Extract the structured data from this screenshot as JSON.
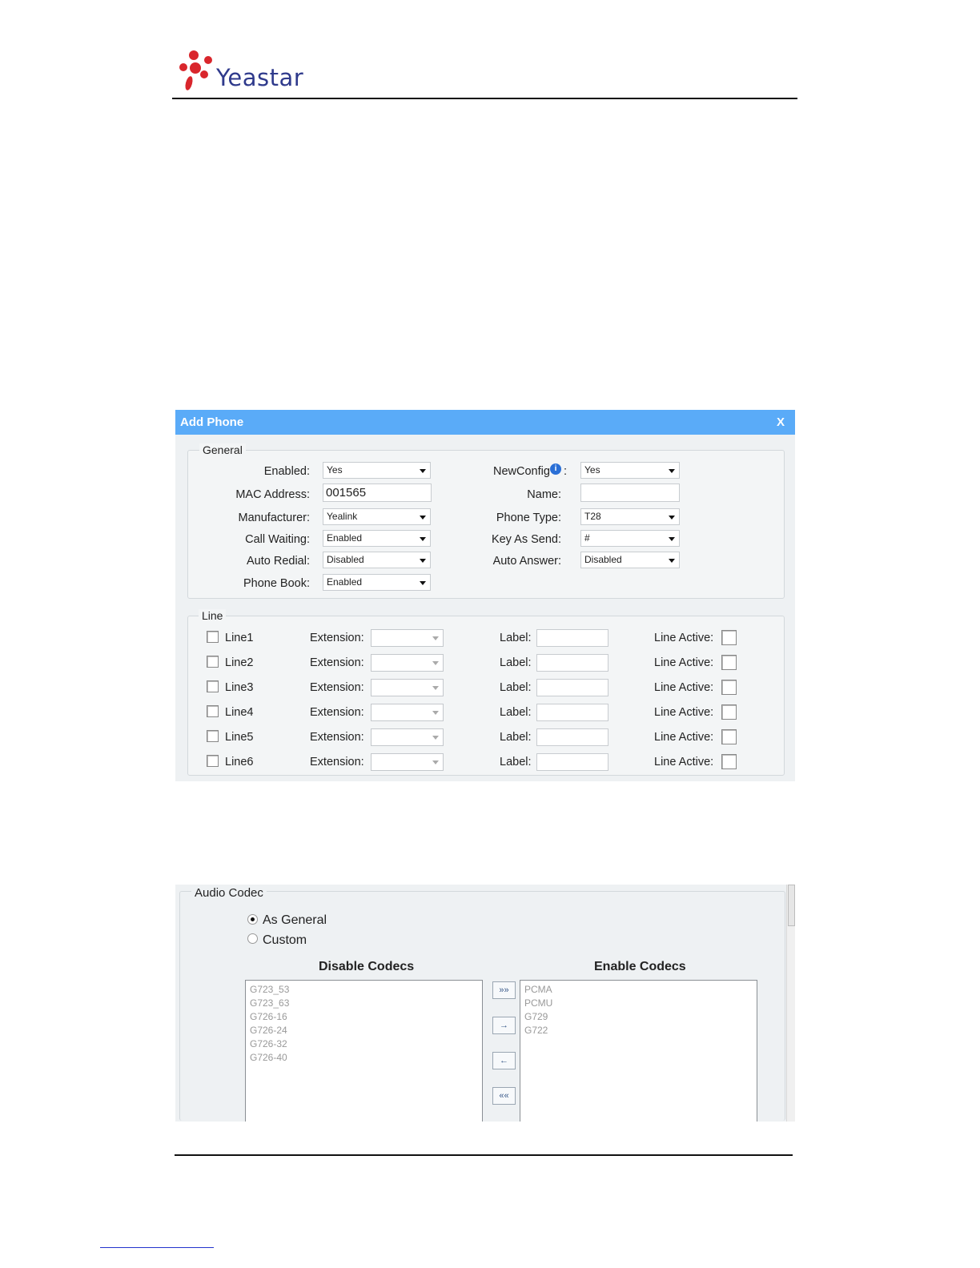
{
  "header": {
    "logo_text": "Yeastar"
  },
  "add_phone": {
    "title": "Add Phone",
    "close_label": "X",
    "general": {
      "legend": "General",
      "left": [
        {
          "label": "Enabled:",
          "value": "Yes",
          "kind": "select"
        },
        {
          "label": "MAC Address:",
          "value": "001565",
          "kind": "input"
        },
        {
          "label": "Manufacturer:",
          "value": "Yealink",
          "kind": "select"
        },
        {
          "label": "Call Waiting:",
          "value": "Enabled",
          "kind": "select"
        },
        {
          "label": "Auto Redial:",
          "value": "Disabled",
          "kind": "select"
        },
        {
          "label": "Phone Book:",
          "value": "Enabled",
          "kind": "select"
        }
      ],
      "right": [
        {
          "label": "NewConfig",
          "value": "Yes",
          "kind": "select",
          "info": true
        },
        {
          "label": "Name:",
          "value": "",
          "kind": "input"
        },
        {
          "label": "Phone Type:",
          "value": "T28",
          "kind": "select"
        },
        {
          "label": "Key As Send:",
          "value": "#",
          "kind": "select"
        },
        {
          "label": "Auto Answer:",
          "value": "Disabled",
          "kind": "select"
        }
      ],
      "newconfig_suffix": ":"
    },
    "line": {
      "legend": "Line",
      "extension_label": "Extension:",
      "label_label": "Label:",
      "line_active_label": "Line Active:",
      "rows": [
        {
          "name": "Line1"
        },
        {
          "name": "Line2"
        },
        {
          "name": "Line3"
        },
        {
          "name": "Line4"
        },
        {
          "name": "Line5"
        },
        {
          "name": "Line6"
        }
      ]
    }
  },
  "audio_codec": {
    "legend": "Audio Codec",
    "options": [
      {
        "label": "As General",
        "selected": true
      },
      {
        "label": "Custom",
        "selected": false
      }
    ],
    "disable_title": "Disable Codecs",
    "enable_title": "Enable Codecs",
    "disabled_codecs": [
      "G723_53",
      "G723_63",
      "G726-16",
      "G726-24",
      "G726-32",
      "G726-40"
    ],
    "enabled_codecs": [
      "PCMA",
      "PCMU",
      "G729",
      "G722"
    ],
    "buttons": [
      "»»",
      "→",
      "←",
      "««"
    ]
  },
  "colors": {
    "title_bar": "#5aabf8",
    "logo_text": "#2f3a8c",
    "logo_mark": "#d9262c"
  }
}
